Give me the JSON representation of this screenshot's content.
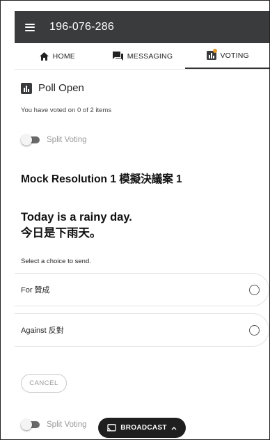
{
  "header": {
    "menu_icon": "hamburger-menu-icon",
    "meeting_id": "196-076-286"
  },
  "tabs": [
    {
      "label": "HOME",
      "icon": "home-icon"
    },
    {
      "label": "MESSAGING",
      "icon": "chat-icon"
    },
    {
      "label": "VOTING",
      "icon": "poll-icon",
      "active": true,
      "notification_dot_color": "#e69a2c"
    }
  ],
  "poll": {
    "status_title": "Poll Open",
    "voted_text": "You have voted on 0 of 2 items",
    "split_voting_label": "Split Voting"
  },
  "resolution": {
    "title": "Mock Resolution 1 模擬決議案 1",
    "question_en": "Today is a rainy day.",
    "question_zh": "今日是下雨天。",
    "select_prompt": "Select a choice to send.",
    "choices": [
      {
        "label": "For 贊成"
      },
      {
        "label": "Against 反對"
      }
    ],
    "cancel_label": "CANCEL"
  },
  "footer": {
    "split_voting_label": "Split Voting",
    "broadcast_label": "BROADCAST",
    "broadcast_icon": "cast-icon"
  },
  "colors": {
    "topbar": "#3a3b3d",
    "accent_dot": "#e69a2c",
    "broadcast_bg": "#1f1f1f"
  }
}
